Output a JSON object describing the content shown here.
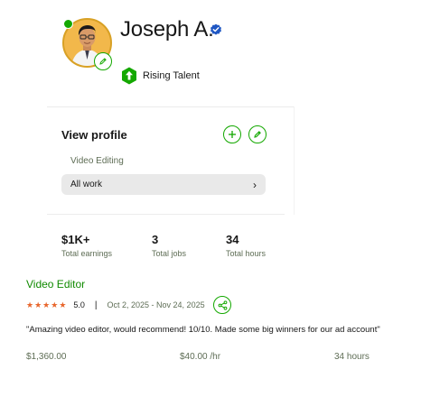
{
  "profile": {
    "name": "Joseph A.",
    "badge": "Rising Talent"
  },
  "card": {
    "title": "View profile",
    "specialization": "Video Editing",
    "all_work_label": "All work"
  },
  "stats": [
    {
      "value": "$1K+",
      "label": "Total earnings"
    },
    {
      "value": "3",
      "label": "Total jobs"
    },
    {
      "value": "34",
      "label": "Total hours"
    }
  ],
  "job": {
    "title": "Video Editor",
    "rating": "5.0",
    "separator": "|",
    "dates": "Oct 2, 2025 - Nov 24, 2025",
    "review": "\"Amazing video editor, would recommend! 10/10. Made some big winners for our ad account\"",
    "amount": "$1,360.00",
    "rate": "$40.00 /hr",
    "hours": "34 hours",
    "stars": 5
  },
  "colors": {
    "accent": "#14a800",
    "link": "#108a00",
    "star": "#e8662c",
    "verified": "#1f57c3",
    "muted": "#5e6d55"
  },
  "icons": {
    "online": "online-dot",
    "avatar_edit": "pencil-icon",
    "verified": "verified-check-icon",
    "badge": "rising-talent-arrow-icon",
    "add": "plus-icon",
    "edit": "pencil-icon",
    "all_work": "chevron-right-icon",
    "share": "share-icon",
    "star": "star-icon"
  }
}
